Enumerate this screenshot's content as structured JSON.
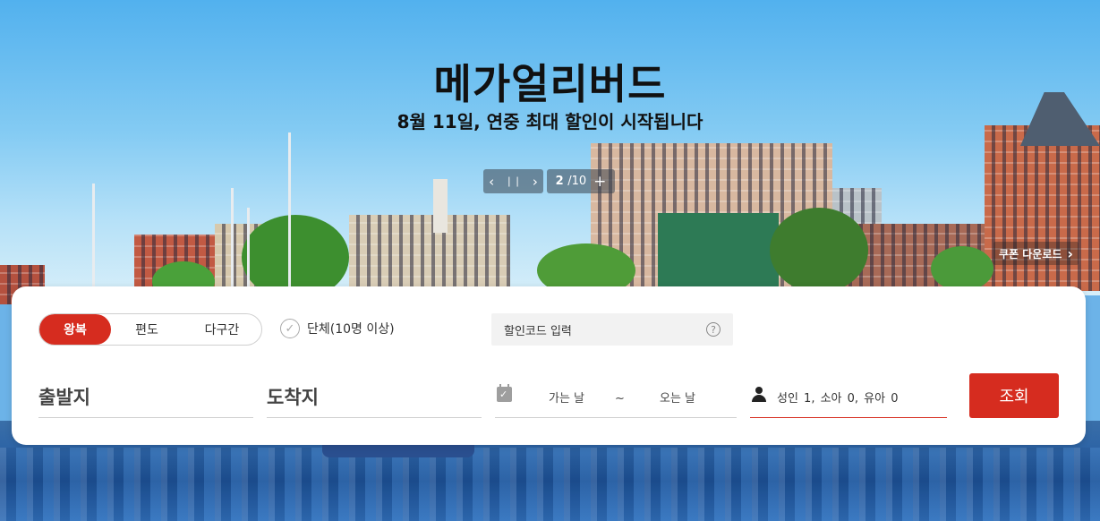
{
  "hero": {
    "title": "메가얼리버드",
    "subtitle": "8월 11일, 연중 최대 할인이 시작됩니다"
  },
  "slider": {
    "prev_icon": "chevron-left-icon",
    "pause_icon": "pause-icon",
    "next_icon": "chevron-right-icon",
    "current": "2",
    "total": "/10",
    "expand_icon": "plus-icon"
  },
  "coupon": {
    "label": "쿠폰 다운로드"
  },
  "search": {
    "trip_types": [
      "왕복",
      "편도",
      "다구간"
    ],
    "active_trip_type": "왕복",
    "group_label": "단체(10명 이상)",
    "promo_code_label": "할인코드 입력",
    "promo_help": "?",
    "origin_label": "출발지",
    "destination_label": "도착지",
    "depart_label": "가는 날",
    "date_separator": "~",
    "return_label": "오는 날",
    "passengers": "성인 1, 소아 0, 유아 0",
    "submit_label": "조회"
  },
  "colors": {
    "accent": "#d62c1f"
  }
}
